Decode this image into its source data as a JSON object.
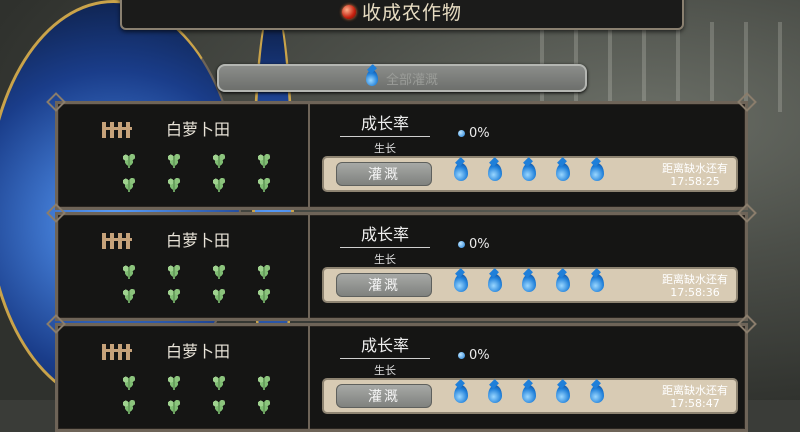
{
  "header": {
    "title": "收成农作物"
  },
  "water_all": {
    "label": "全部灌溉"
  },
  "fields": [
    {
      "name": "白萝卜田",
      "rate_label": "成长率",
      "stage_label": "生长",
      "percent": "0%",
      "water_button": "灌溉",
      "drops": 5,
      "countdown_label": "距离缺水还有",
      "countdown_time": "17:58:25"
    },
    {
      "name": "白萝卜田",
      "rate_label": "成长率",
      "stage_label": "生长",
      "percent": "0%",
      "water_button": "灌溉",
      "drops": 5,
      "countdown_label": "距离缺水还有",
      "countdown_time": "17:58:36"
    },
    {
      "name": "白萝卜田",
      "rate_label": "成长率",
      "stage_label": "生长",
      "percent": "0%",
      "water_button": "灌溉",
      "drops": 5,
      "countdown_label": "距离缺水还有",
      "countdown_time": "17:58:47"
    }
  ],
  "colors": {
    "panel_bg": "#151514",
    "panel_border": "#6e6458",
    "water_bar": "#d8cbb4",
    "drop_blue": "#1f7fd9"
  },
  "icons": {
    "title_orb": "red-orb-icon",
    "drop": "water-drop-icon",
    "fence": "fence-icon",
    "plant": "carrot-sprout-icon"
  }
}
